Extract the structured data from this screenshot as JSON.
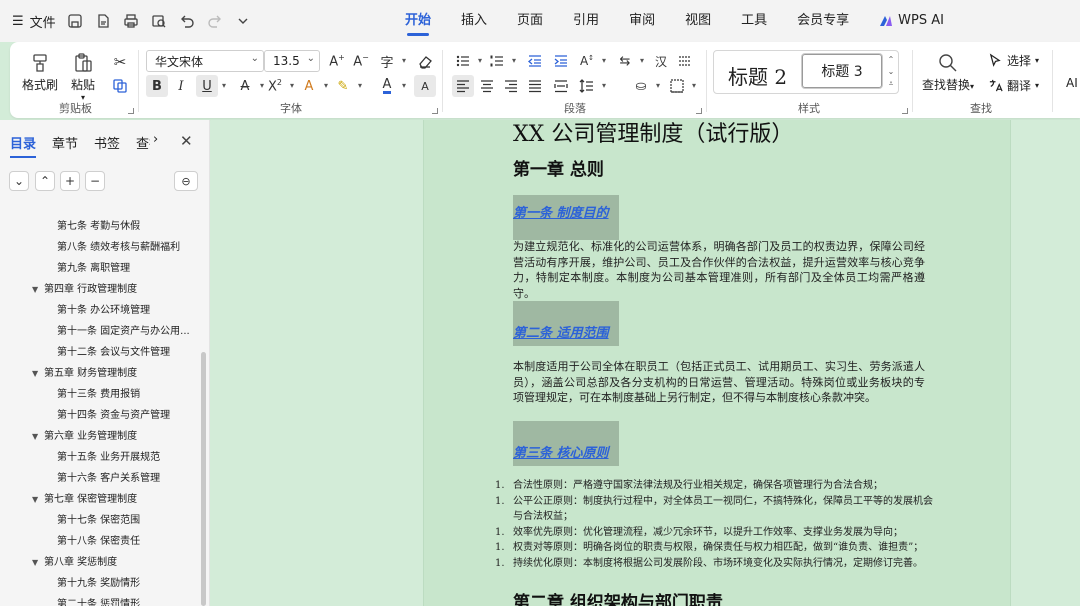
{
  "menubar": {
    "file_label": "文件",
    "tabs": [
      "开始",
      "插入",
      "页面",
      "引用",
      "审阅",
      "视图",
      "工具",
      "会员专享"
    ],
    "active_tab": "开始",
    "ai_label": "WPS AI"
  },
  "ribbon": {
    "clipboard": {
      "format_painter": "格式刷",
      "paste": "粘贴",
      "group": "剪贴板"
    },
    "font": {
      "family": "华文宋体",
      "size": "13.5",
      "group": "字体"
    },
    "paragraph": {
      "group": "段落"
    },
    "styles": {
      "style_a": "标题 2",
      "style_b": "标题 3",
      "group": "样式"
    },
    "find": {
      "find_replace": "查找替换",
      "select": "选择",
      "translate": "翻译",
      "group": "查找",
      "ai": "AI"
    }
  },
  "sidebar": {
    "tabs": [
      "目录",
      "章节",
      "书签",
      "查找"
    ],
    "active_tab": "目录",
    "toc": [
      {
        "level": 1,
        "text": "第七条  考勤与休假"
      },
      {
        "level": 1,
        "text": "第八条  绩效考核与薪酬福利"
      },
      {
        "level": 1,
        "text": "第九条  离职管理"
      },
      {
        "level": 0,
        "text": "第四章  行政管理制度"
      },
      {
        "level": 1,
        "text": "第十条  办公环境管理"
      },
      {
        "level": 1,
        "text": "第十一条  固定资产与办公用..."
      },
      {
        "level": 1,
        "text": "第十二条  会议与文件管理"
      },
      {
        "level": 0,
        "text": "第五章  财务管理制度"
      },
      {
        "level": 1,
        "text": "第十三条  费用报销"
      },
      {
        "level": 1,
        "text": "第十四条  资金与资产管理"
      },
      {
        "level": 0,
        "text": "第六章  业务管理制度"
      },
      {
        "level": 1,
        "text": "第十五条  业务开展规范"
      },
      {
        "level": 1,
        "text": "第十六条  客户关系管理"
      },
      {
        "level": 0,
        "text": "第七章  保密管理制度"
      },
      {
        "level": 1,
        "text": "第十七条  保密范围"
      },
      {
        "level": 1,
        "text": "第十八条  保密责任"
      },
      {
        "level": 0,
        "text": "第八章  奖惩制度"
      },
      {
        "level": 1,
        "text": "第十九条  奖励情形"
      },
      {
        "level": 1,
        "text": "第二十条  惩罚情形"
      }
    ]
  },
  "document": {
    "title": "XX 公司管理制度（试行版）",
    "chapter1": "第一章  总则",
    "art1_title": "第一条  制度目的",
    "art1_text": "为建立规范化、标准化的公司运营体系，明确各部门及员工的权责边界，保障公司经营活动有序开展，维护公司、员工及合作伙伴的合法权益，提升运营效率与核心竞争力，特制定本制度。本制度为公司基本管理准则，所有部门及全体员工均需严格遵守。",
    "art2_title": "第二条  适用范围",
    "art2_text": "本制度适用于公司全体在职员工（包括正式员工、试用期员工、实习生、劳务派遣人员），涵盖公司总部及各分支机构的日常运营、管理活动。特殊岗位或业务板块的专项管理规定，可在本制度基础上另行制定，但不得与本制度核心条款冲突。",
    "art3_title": "第三条  核心原则",
    "principles": [
      {
        "num": "1.",
        "text": "合法性原则：严格遵守国家法律法规及行业相关规定，确保各项管理行为合法合规；"
      },
      {
        "num": "1.",
        "text": "公平公正原则：制度执行过程中，对全体员工一视同仁，不搞特殊化，保障员工平等的发展机会与合法权益；"
      },
      {
        "num": "1.",
        "text": "效率优先原则：优化管理流程，减少冗余环节，以提升工作效率、支撑业务发展为导向；"
      },
      {
        "num": "1.",
        "text": "权责对等原则：明确各岗位的职责与权限，确保责任与权力相匹配，做到“谁负责、谁担责”；"
      },
      {
        "num": "1.",
        "text": "持续优化原则：本制度将根据公司发展阶段、市场环境变化及实际执行情况，定期修订完善。"
      }
    ],
    "chapter2": "第二章  组织架构与部门职责"
  },
  "colors": {
    "accent": "#2c62d8",
    "page_bg": "#c8e6cc",
    "canvas_bg": "#d3ecd8",
    "heading_highlight": "#9fb8a2"
  }
}
